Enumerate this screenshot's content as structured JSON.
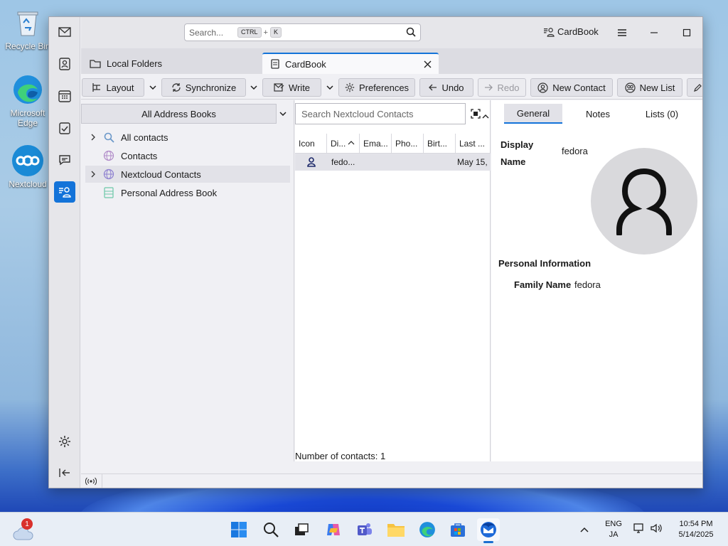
{
  "desktop": {
    "icons": [
      {
        "label": "Recycle Bin"
      },
      {
        "label": "Microsoft Edge"
      },
      {
        "label": "Nextcloud"
      }
    ]
  },
  "window": {
    "search_placeholder": "Search...",
    "search_key1": "CTRL",
    "search_plus": "+",
    "search_key2": "K",
    "app_button": "CardBook"
  },
  "tabs": [
    {
      "label": "Local Folders"
    },
    {
      "label": "CardBook"
    }
  ],
  "toolbar": {
    "layout": "Layout",
    "synchronize": "Synchronize",
    "write": "Write",
    "preferences": "Preferences",
    "undo": "Undo",
    "redo": "Redo",
    "new_contact": "New Contact",
    "new_list": "New List"
  },
  "address_books": {
    "selector": "All Address Books",
    "items": [
      {
        "label": "All contacts"
      },
      {
        "label": "Contacts"
      },
      {
        "label": "Nextcloud Contacts"
      },
      {
        "label": "Personal Address Book"
      }
    ]
  },
  "contacts_list": {
    "search_placeholder": "Search Nextcloud Contacts",
    "columns": [
      "Icon",
      "Di...",
      "Ema...",
      "Pho...",
      "Birt...",
      "Last ..."
    ],
    "rows": [
      {
        "display": "fedo...",
        "last": "May 15,"
      }
    ],
    "count": "Number of contacts: 1"
  },
  "detail": {
    "tabs": [
      "General",
      "Notes",
      "Lists (0)"
    ],
    "display_name_label_1": "Display",
    "display_name_label_2": "Name",
    "display_name_value": "fedora",
    "section_title": "Personal Information",
    "family_name_label": "Family Name",
    "family_name_value": "fedora"
  },
  "taskbar": {
    "notification_count": "1",
    "lang_1": "ENG",
    "lang_2": "JA",
    "time": "10:54 PM",
    "date": "5/14/2025"
  },
  "colors": {
    "accent": "#1373d9",
    "window_bg": "#f0f0f4",
    "selected_row": "#e2e2e8"
  }
}
